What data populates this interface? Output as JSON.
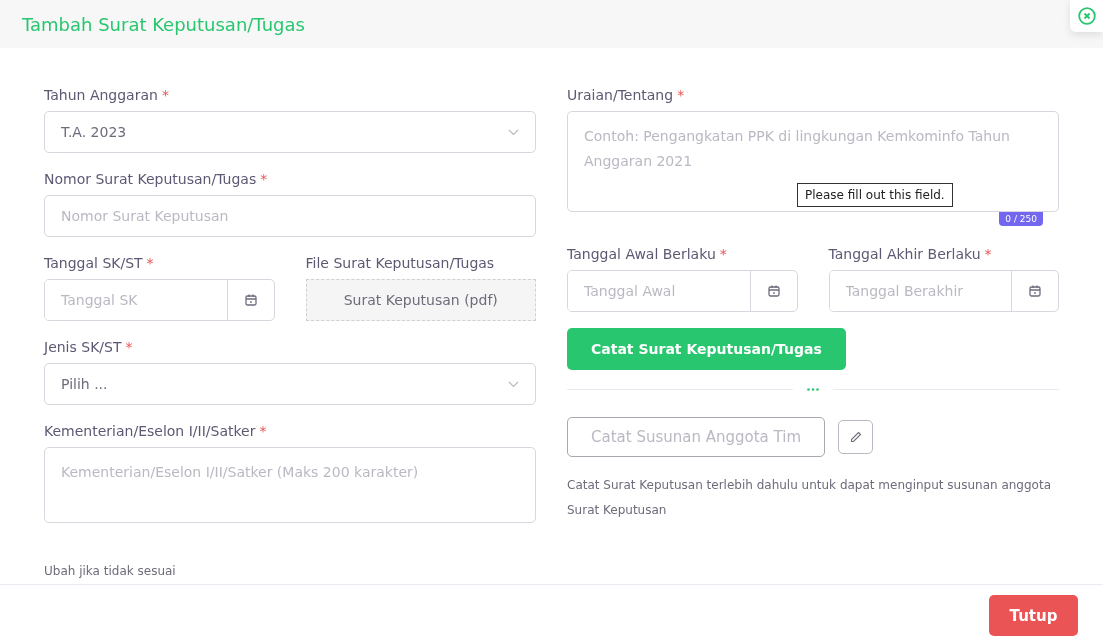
{
  "dialog": {
    "title": "Tambah Surat Keputusan/Tugas"
  },
  "left_column": [
    {
      "kind": "select",
      "label": "Tahun Anggaran",
      "required_mark": "*",
      "value": "T.A. 2023"
    },
    {
      "kind": "text",
      "label": "Nomor Surat Keputusan/Tugas",
      "required_mark": "*",
      "placeholder": "Nomor Surat Keputusan"
    },
    {
      "kind": "row",
      "fields": [
        {
          "kind": "date",
          "label": "Tanggal SK/ST",
          "required_mark": "*",
          "placeholder": "Tanggal SK"
        },
        {
          "kind": "file",
          "label": "File Surat Keputusan/Tugas",
          "button": "Surat Keputusan (pdf)"
        }
      ]
    },
    {
      "kind": "select",
      "label": "Jenis SK/ST",
      "required_mark": "*",
      "value": "Pilih ..."
    },
    {
      "kind": "textarea",
      "label": "Kementerian/Eselon I/II/Satker",
      "required_mark": "*",
      "placeholder": "Kementerian/Eselon I/II/Satker (Maks 200 karakter)"
    },
    {
      "kind": "note",
      "text": "Ubah jika tidak sesuai"
    }
  ],
  "right_column": [
    {
      "kind": "textarea",
      "label": "Uraian/Tentang",
      "required_mark": "*",
      "placeholder": "Contoh: Pengangkatan PPK di lingkungan Kemkominfo Tahun Anggaran 2021",
      "counter": "0 / 250",
      "tooltip": "Please fill out this field."
    },
    {
      "kind": "row",
      "fields": [
        {
          "kind": "date",
          "label": "Tanggal Awal Berlaku",
          "required_mark": "*",
          "placeholder": "Tanggal Awal"
        },
        {
          "kind": "date",
          "label": "Tanggal Akhir Berlaku",
          "required_mark": "*",
          "placeholder": "Tanggal Berakhir"
        }
      ]
    },
    {
      "kind": "button",
      "label": "Catat Surat Keputusan/Tugas"
    },
    {
      "kind": "divider"
    },
    {
      "kind": "team",
      "label": "Catat Susunan Anggota Tim",
      "disabled": true
    },
    {
      "kind": "note",
      "text": "Catat Surat Keputusan terlebih dahulu untuk dapat menginput susunan anggota Surat Keputusan"
    }
  ],
  "footer": {
    "close_button": "Tutup"
  }
}
